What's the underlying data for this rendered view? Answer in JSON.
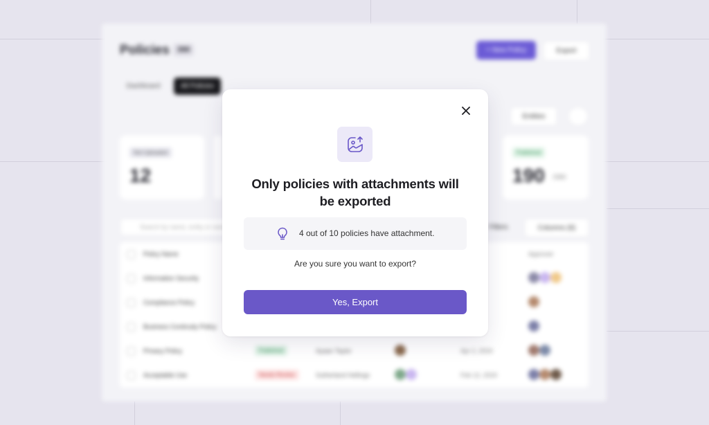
{
  "background_app": {
    "title": "Policies",
    "title_count": "390",
    "new_button": "+ New Policy",
    "export_button": "Export",
    "tabs": [
      {
        "label": "Dashboard"
      },
      {
        "label": "All Policies"
      }
    ],
    "entities_filter": "Entities",
    "filters_button": "Filters",
    "columns_button": "Columns (6)",
    "search_placeholder": "Search by name, entity or owner",
    "cards": [
      {
        "badge": "Not Uploaded",
        "value": "12",
        "sub": ""
      },
      {
        "badge": "Published",
        "value": "190",
        "sub": "/390"
      }
    ],
    "table_headers": [
      "Policy Name",
      "Approver"
    ],
    "rows": [
      {
        "name": "Information Security",
        "status": "",
        "owner": "",
        "date": ""
      },
      {
        "name": "Compliance Policy",
        "status": "",
        "owner": "",
        "date": ""
      },
      {
        "name": "Business Continuity Policy",
        "status": "",
        "owner": "",
        "date": ""
      },
      {
        "name": "Privacy Policy",
        "status": "Published",
        "owner": "Ayaan Taylor",
        "date": "Apr 2, 2024"
      },
      {
        "name": "Acceptable Use",
        "status": "Needs Review",
        "owner": "Sutherland Hellings",
        "date": "Feb 12, 2024"
      }
    ]
  },
  "modal": {
    "close_icon": "close-icon",
    "image_icon": "image-upload-icon",
    "title": "Only policies with attachments will be exported",
    "info_icon": "lightbulb-icon",
    "info_text": "4 out of 10 policies have attachment.",
    "confirm_text": "Are you sure you want to export?",
    "primary_button": "Yes, Export"
  },
  "colors": {
    "accent": "#6a58c8",
    "icon_tile_bg": "#ece9f8",
    "info_bg": "#f5f5f8",
    "page_bg": "#e6e4ee"
  }
}
